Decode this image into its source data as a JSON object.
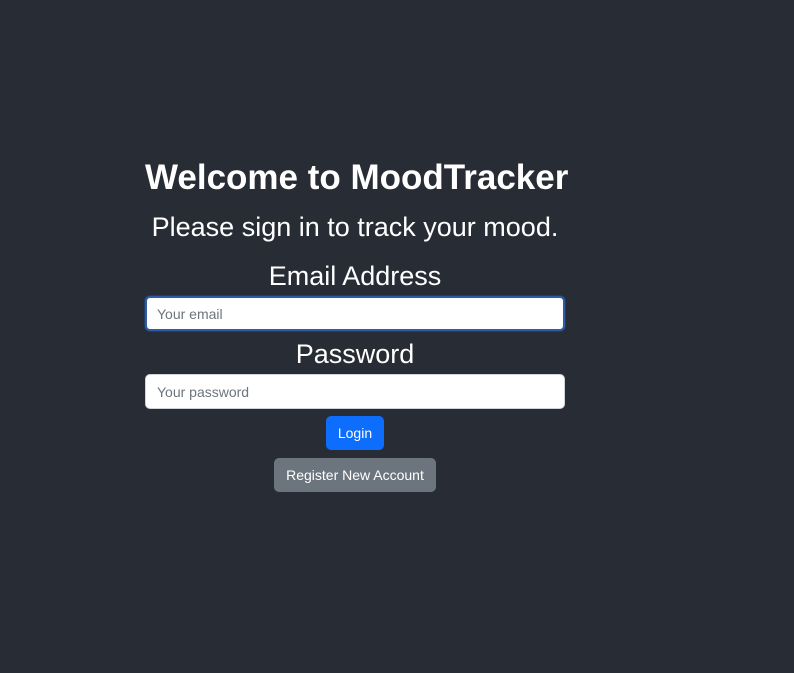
{
  "page": {
    "title": "Welcome to MoodTracker",
    "subtitle": "Please sign in to track your mood."
  },
  "form": {
    "email_label": "Email Address",
    "email_placeholder": "Your email",
    "email_value": "",
    "password_label": "Password",
    "password_placeholder": "Your password",
    "password_value": "",
    "login_label": "Login",
    "register_label": "Register New Account"
  },
  "colors": {
    "background": "#282c34",
    "primary": "#0d6efd",
    "secondary": "#6c757d",
    "text": "#ffffff"
  }
}
